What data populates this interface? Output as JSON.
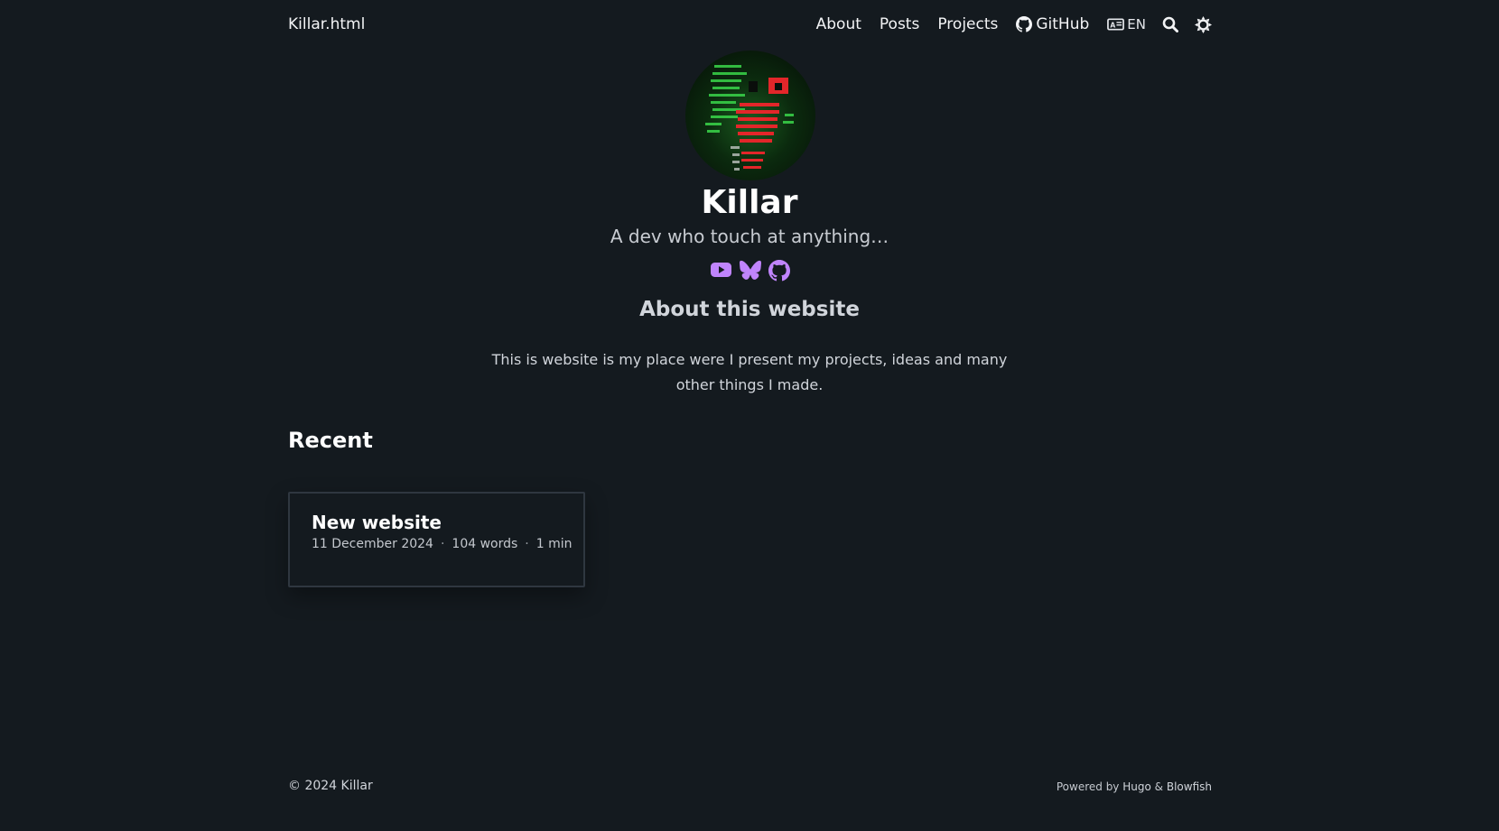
{
  "header": {
    "site_title": "Killar.html",
    "nav": [
      {
        "label": "About"
      },
      {
        "label": "Posts"
      },
      {
        "label": "Projects"
      },
      {
        "label": "GitHub",
        "icon": "github-icon"
      }
    ],
    "language": "EN",
    "search_icon": "search-icon",
    "theme_icon": "sun-icon"
  },
  "profile": {
    "name": "Killar",
    "tagline": "A dev who touch at anything…",
    "socials": [
      {
        "icon": "youtube-icon"
      },
      {
        "icon": "bluesky-icon"
      },
      {
        "icon": "github-icon"
      }
    ],
    "accent_color": "#c084fc"
  },
  "about": {
    "heading": "About this website",
    "text": "This is website is my place were I present my projects, ideas and many other things I made."
  },
  "recent": {
    "heading": "Recent",
    "posts": [
      {
        "title": "New website",
        "date": "11 December 2024",
        "words": "104 words",
        "read_time": "1 min"
      }
    ]
  },
  "footer": {
    "copyright": "© 2024 Killar",
    "powered_prefix": "Powered by",
    "hugo": "Hugo",
    "amp": "&",
    "blowfish": "Blowfish"
  }
}
